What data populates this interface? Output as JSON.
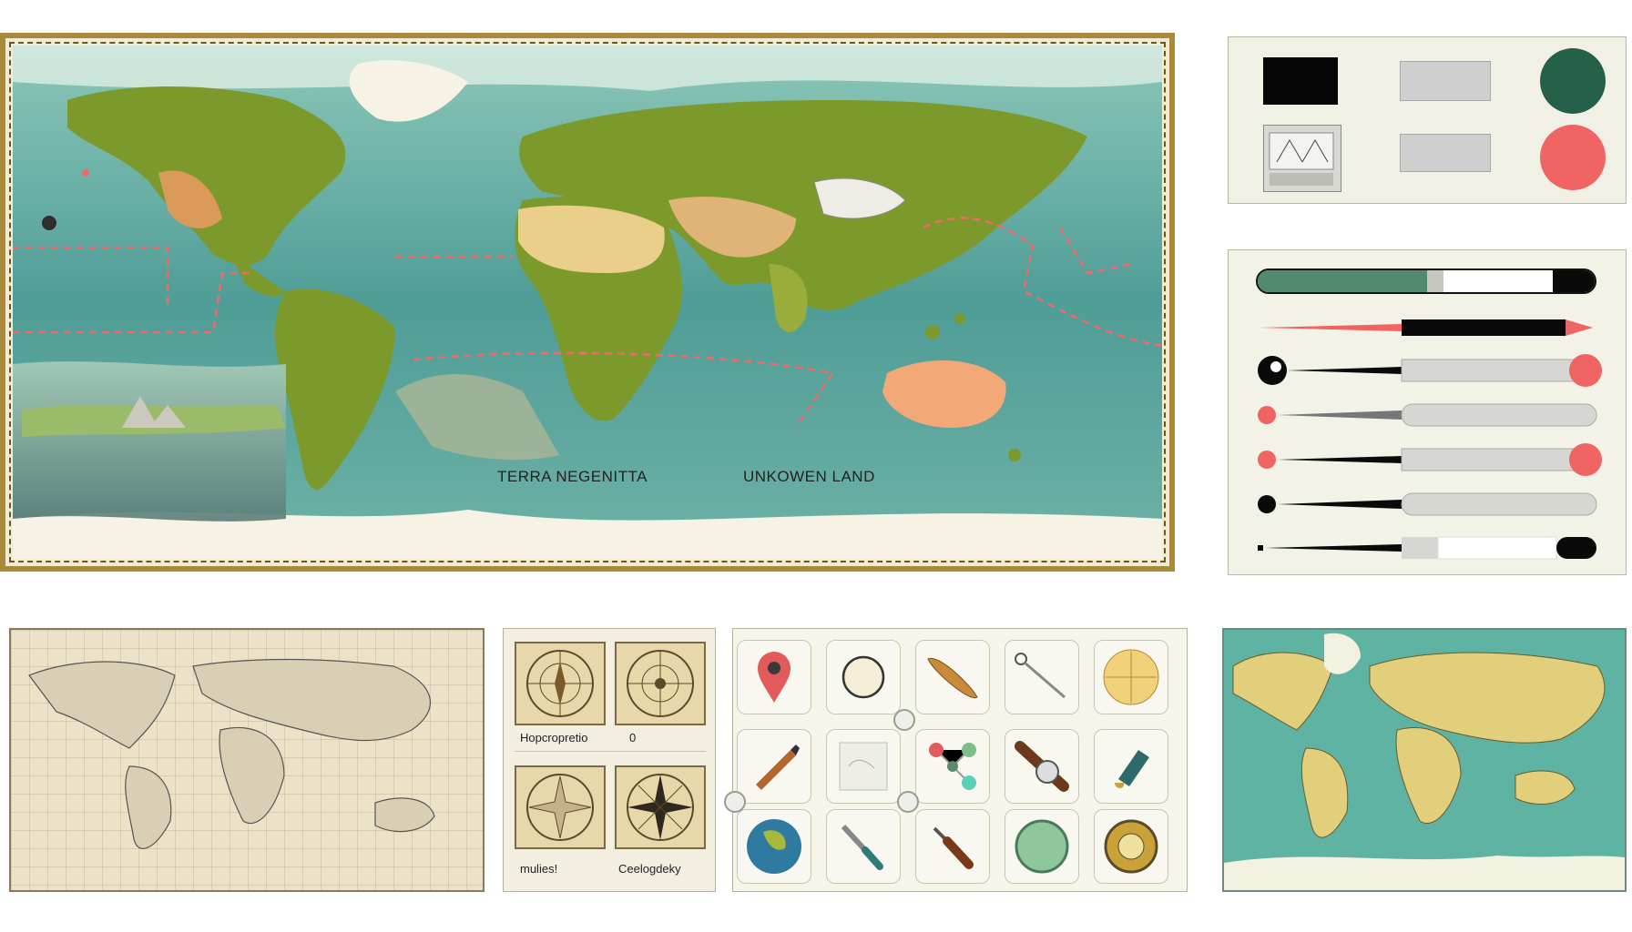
{
  "main_map": {
    "labels": {
      "terra": "TERRA NEGENITTA",
      "unknown": "UNKOWEN LAND"
    },
    "colors": {
      "ocean": "#4f9d97",
      "ocean_light": "#8cc7b8",
      "land": "#7c9a2c",
      "desert": "#e9cf8a",
      "frame": "#a98a3b",
      "route": "#f06a6a"
    }
  },
  "swatch_panel": {
    "colors": {
      "black": "#050505",
      "gray": "#cfcfcf",
      "green": "#24604a",
      "coral": "#f06464"
    }
  },
  "slider_panel": {
    "colors": {
      "green": "#4f8a6f",
      "coral": "#f06464",
      "black": "#0a0a0a",
      "track": "#d6d6d2"
    }
  },
  "compass_panel": {
    "labels": {
      "top_left": "Hopcropretio",
      "top_right": "0",
      "bottom_left": "mulies!",
      "bottom_right": "Ceelogdeky"
    }
  },
  "tool_palette": {
    "icons": [
      "map-pin-icon",
      "clock-icon",
      "wooden-plank-icon",
      "magnifier-pin-icon",
      "compass-rose-icon",
      "pencil-icon",
      "map-sketch-icon",
      "molecule-nodes-icon",
      "wristwatch-icon",
      "ink-bottle-icon",
      "globe-icon",
      "knife-icon",
      "carving-tool-icon",
      "green-lens-icon",
      "astrolabe-icon"
    ]
  },
  "mini_map": {
    "colors": {
      "ocean": "#5fb3a3",
      "land": "#e2cf7c",
      "ice": "#f3f1df"
    }
  }
}
